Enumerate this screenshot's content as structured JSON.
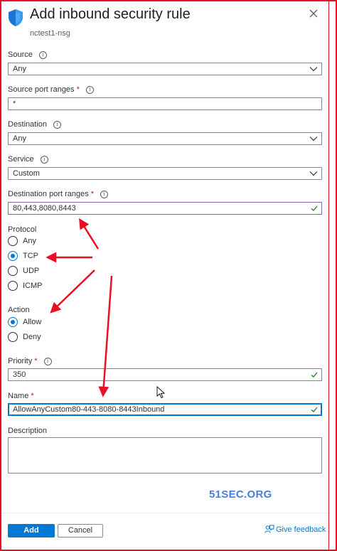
{
  "header": {
    "title": "Add inbound security rule",
    "subtitle": "nctest1-nsg"
  },
  "form": {
    "source": {
      "label": "Source",
      "value": "Any"
    },
    "source_port_ranges": {
      "label": "Source port ranges",
      "required": "*",
      "value": "*"
    },
    "destination": {
      "label": "Destination",
      "value": "Any"
    },
    "service": {
      "label": "Service",
      "value": "Custom"
    },
    "destination_port_ranges": {
      "label": "Destination port ranges",
      "required": "*",
      "value": "80,443,8080,8443"
    },
    "protocol": {
      "label": "Protocol",
      "options": [
        "Any",
        "TCP",
        "UDP",
        "ICMP"
      ],
      "selected": "TCP"
    },
    "action": {
      "label": "Action",
      "options": [
        "Allow",
        "Deny"
      ],
      "selected": "Allow"
    },
    "priority": {
      "label": "Priority",
      "required": "*",
      "value": "350"
    },
    "name": {
      "label": "Name",
      "required": "*",
      "value": "AllowAnyCustom80-443-8080-8443Inbound"
    },
    "description": {
      "label": "Description",
      "value": ""
    }
  },
  "watermark": "51SEC.ORG",
  "footer": {
    "add_label": "Add",
    "cancel_label": "Cancel",
    "feedback_label": "Give feedback"
  },
  "colors": {
    "accent": "#0078d4",
    "annotation_red": "#e81123",
    "valid_green": "#107c10"
  }
}
